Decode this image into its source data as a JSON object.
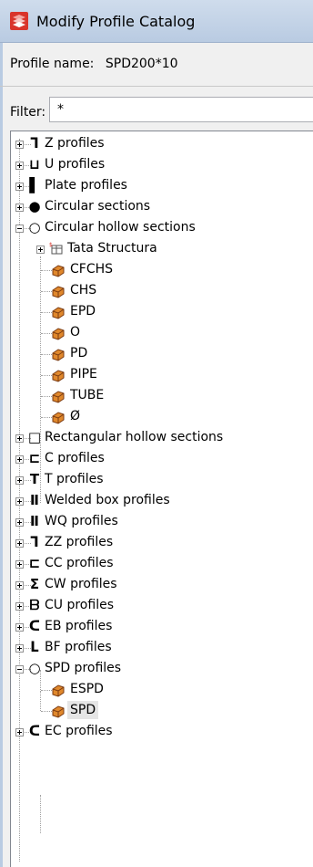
{
  "window": {
    "title": "Modify Profile Catalog"
  },
  "profile": {
    "label": "Profile name:",
    "value": "SPD200*10"
  },
  "filter": {
    "label": "Filter:",
    "value": "*"
  },
  "tree": [
    {
      "label": "Z profiles",
      "icon": "z-profile-icon",
      "glyph": "ᒣ"
    },
    {
      "label": "U profiles",
      "icon": "u-profile-icon",
      "glyph": "⊔"
    },
    {
      "label": "Plate profiles",
      "icon": "plate-profile-icon",
      "glyph": "▌"
    },
    {
      "label": "Circular sections",
      "icon": "circle-filled-icon",
      "glyph": "●"
    },
    {
      "label": "Circular hollow sections",
      "icon": "circle-hollow-icon",
      "glyph": "○"
    },
    {
      "label": "Tata Structura",
      "icon": "catalog-folder-icon"
    },
    {
      "label": "CFCHS",
      "icon": "profile-item-icon"
    },
    {
      "label": "CHS",
      "icon": "profile-item-icon"
    },
    {
      "label": "EPD",
      "icon": "profile-item-icon"
    },
    {
      "label": "O",
      "icon": "profile-item-icon"
    },
    {
      "label": "PD",
      "icon": "profile-item-icon"
    },
    {
      "label": "PIPE",
      "icon": "profile-item-icon"
    },
    {
      "label": "TUBE",
      "icon": "profile-item-icon"
    },
    {
      "label": "Ø",
      "icon": "profile-item-icon"
    },
    {
      "label": "Rectangular hollow sections",
      "icon": "rect-hollow-icon",
      "glyph": "□"
    },
    {
      "label": "C profiles",
      "icon": "c-profile-icon",
      "glyph": "⊏"
    },
    {
      "label": "T profiles",
      "icon": "t-profile-icon",
      "glyph": "T"
    },
    {
      "label": "Welded box profiles",
      "icon": "welded-box-icon",
      "glyph": "Ⅱ"
    },
    {
      "label": "WQ profiles",
      "icon": "wq-profile-icon",
      "glyph": "Ⅱ"
    },
    {
      "label": "ZZ profiles",
      "icon": "zz-profile-icon",
      "glyph": "ᒣ"
    },
    {
      "label": "CC profiles",
      "icon": "cc-profile-icon",
      "glyph": "⊏"
    },
    {
      "label": "CW profiles",
      "icon": "cw-profile-icon",
      "glyph": "Σ"
    },
    {
      "label": "CU profiles",
      "icon": "cu-profile-icon",
      "glyph": "ᗷ"
    },
    {
      "label": "EB profiles",
      "icon": "eb-profile-icon",
      "glyph": "ᑕ"
    },
    {
      "label": "BF profiles",
      "icon": "bf-profile-icon",
      "glyph": "ᒪ"
    },
    {
      "label": "SPD profiles",
      "icon": "spd-profile-icon",
      "glyph": "○"
    },
    {
      "label": "ESPD",
      "icon": "profile-item-icon"
    },
    {
      "label": "SPD",
      "icon": "profile-item-icon"
    },
    {
      "label": "EC profiles",
      "icon": "ec-profile-icon",
      "glyph": "ᑕ"
    }
  ],
  "colors": {
    "item_icon": "#e0882c",
    "title_bar": "#c4d5ea"
  }
}
